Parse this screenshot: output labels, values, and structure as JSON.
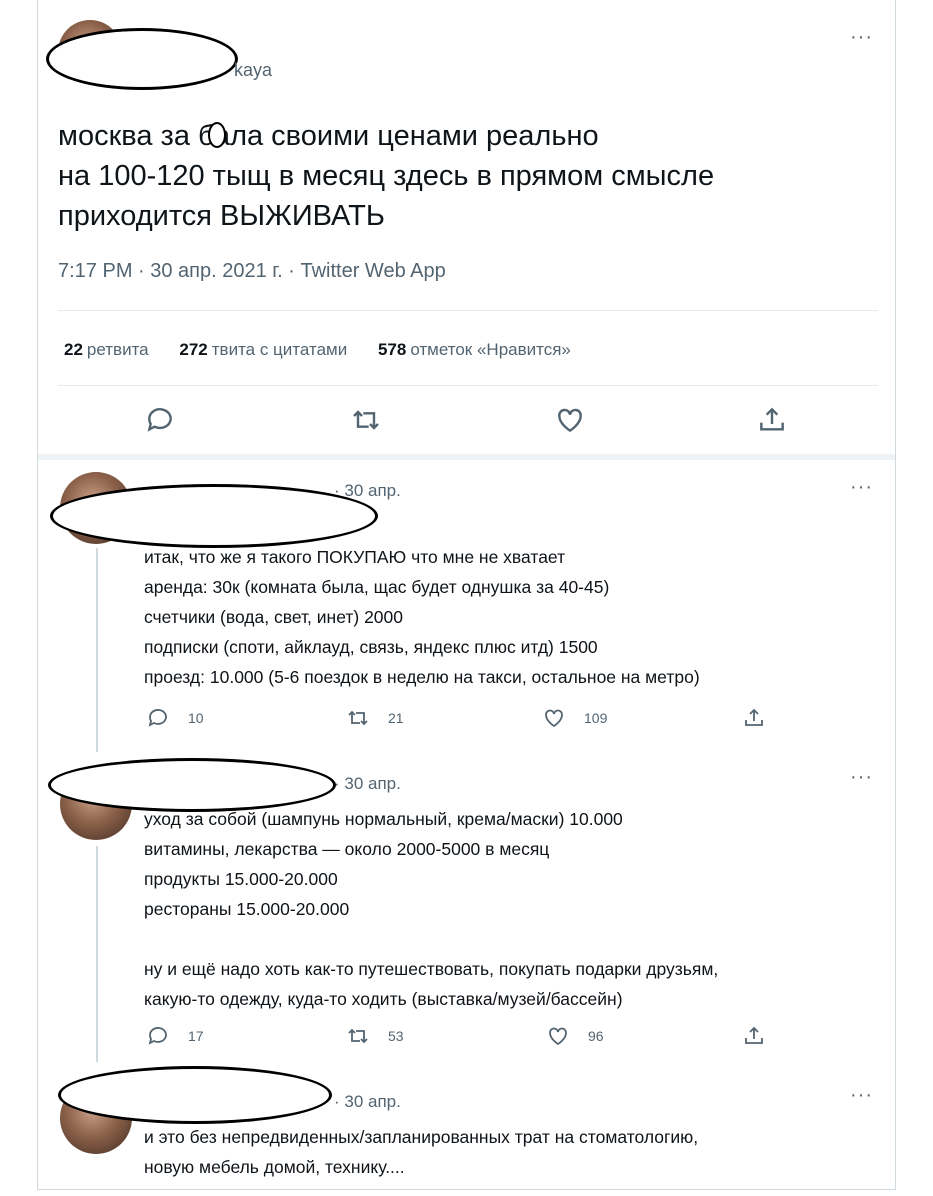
{
  "tweet": {
    "handle_fragment": "kaya",
    "text_lines": [
      "москва за бала своими ценами реально",
      "на 100-120 тыщ в месяц здесь в прямом смысле",
      "приходится ВЫЖИВАТЬ"
    ],
    "meta": "7:17 PM · 30 апр. 2021 г. · Twitter Web App",
    "stats": {
      "retweets_count": "22",
      "retweets_label": "ретвита",
      "quotes_count": "272",
      "quotes_label": "твита с цитатами",
      "likes_count": "578",
      "likes_label": "отметок «Нравится»"
    },
    "more_label": "···"
  },
  "replies": [
    {
      "meta": "· 30 апр.",
      "text": "итак, что же я такого ПОКУПАЮ что мне не хватает\nаренда: 30к (комната была, щас будет однушка за 40-45)\nсчетчики (вода, свет, инет) 2000\nподписки (споти, айклауд, связь, яндекс плюс итд) 1500\nпроезд: 10.000 (5-6 поездок в неделю на такси, остальное на метро)",
      "replies": "10",
      "retweets": "21",
      "likes": "109"
    },
    {
      "meta": "· 30 апр.",
      "text": "уход за собой (шампунь нормальный, крема/маски) 10.000\nвитамины, лекарства — около 2000-5000 в месяц\nпродукты 15.000-20.000\nрестораны 15.000-20.000\n\nну и ещё надо хоть как-то путешествовать, покупать подарки друзьям,\nкакую-то одежду, куда-то ходить (выставка/музей/бассейн)",
      "replies": "17",
      "retweets": "53",
      "likes": "96"
    },
    {
      "meta": "· 30 апр.",
      "text": "и это без непредвиденных/запланированных трат на стоматологию,\nновую мебель домой, технику...."
    }
  ],
  "icons": [
    "reply-icon",
    "retweet-icon",
    "like-icon",
    "share-icon",
    "more-icon"
  ]
}
